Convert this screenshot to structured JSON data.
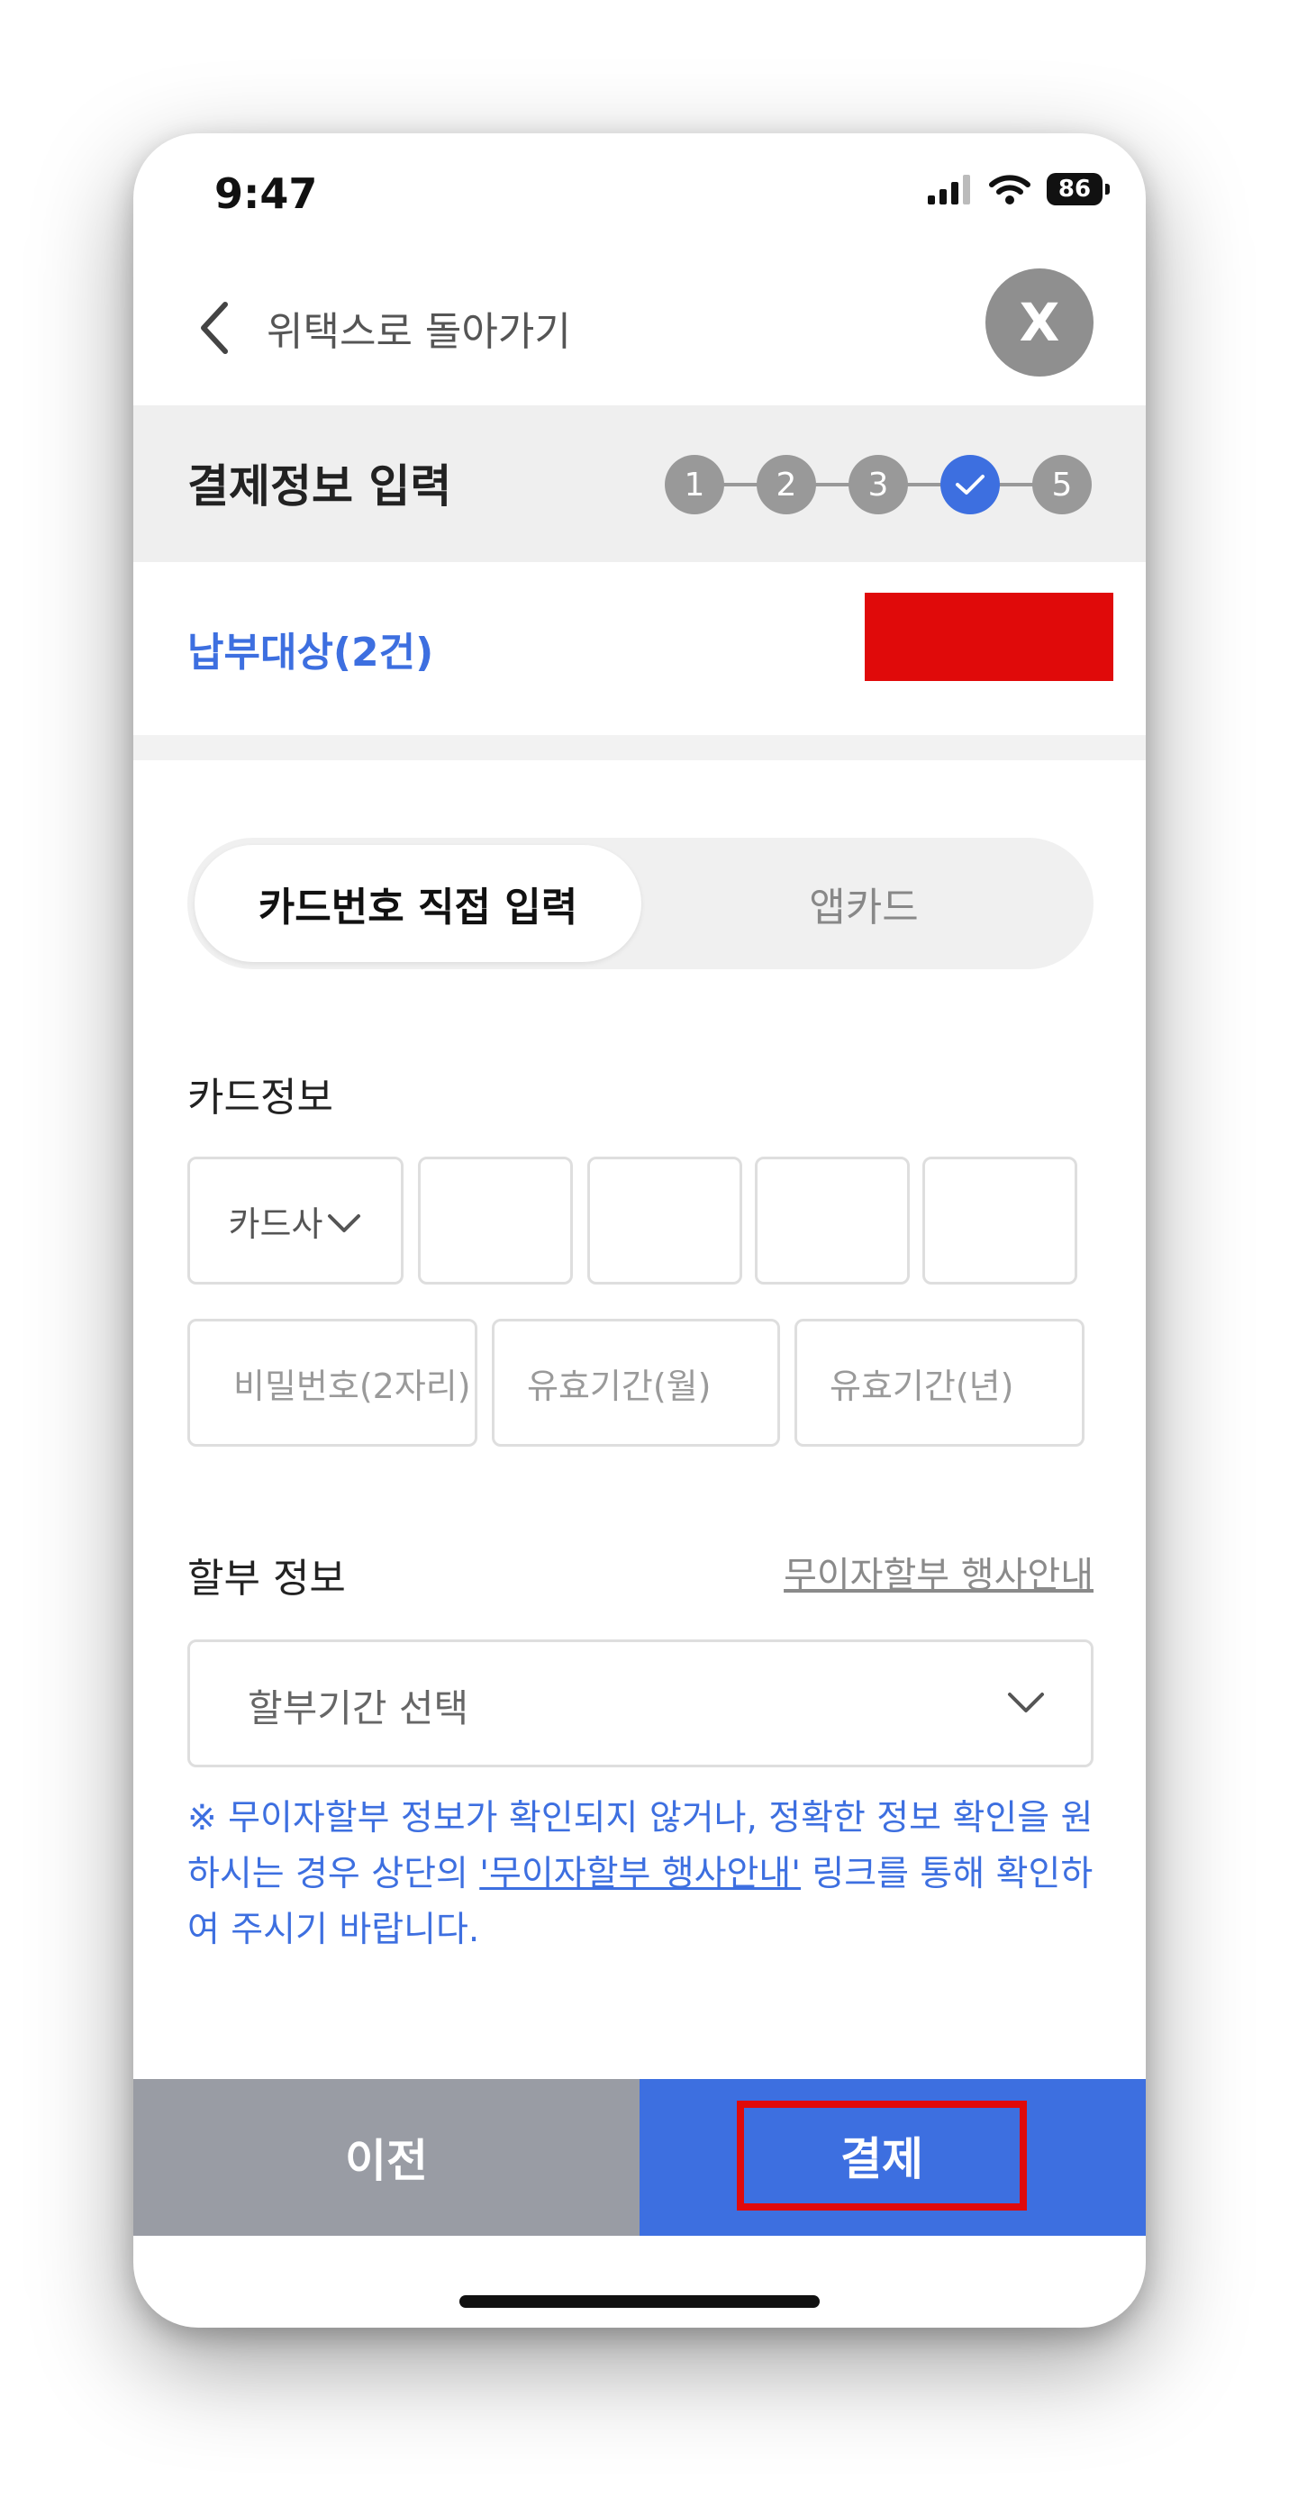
{
  "status_bar": {
    "time": "9:47",
    "battery": "86"
  },
  "header": {
    "back_label": "위택스로 돌아가기",
    "close_label": "X"
  },
  "steps": {
    "title": "결제정보 입력",
    "items": [
      "1",
      "2",
      "3",
      "✓",
      "5"
    ],
    "active_step": 4
  },
  "payment_target": {
    "label": "납부대상(2건)"
  },
  "payment_method": {
    "options": [
      "카드번호 직접 입력",
      "앱카드"
    ],
    "selected": "카드번호 직접 입력"
  },
  "card_info": {
    "label": "카드정보",
    "issuer_select": "카드사",
    "password_placeholder": "비밀번호(2자리)",
    "expiry_month_placeholder": "유효기간(월)",
    "expiry_year_placeholder": "유효기간(년)"
  },
  "installment": {
    "label": "할부 정보",
    "link": "무이자할부 행사안내",
    "select_placeholder": "할부기간 선택"
  },
  "notice": {
    "prefix": "※ 무이자할부 정보가 확인되지 않거나, 정확한 정보 확인을 원하시는 경우 상단의 ",
    "link": "'무이자할부 행사안내'",
    "suffix": " 링크를 통해 확인하여 주시기 바랍니다."
  },
  "footer": {
    "prev_label": "이전",
    "pay_label": "결제"
  },
  "colors": {
    "accent": "#3d6fe0",
    "highlight": "#e00a0a",
    "secondary_button": "#999ca4"
  }
}
